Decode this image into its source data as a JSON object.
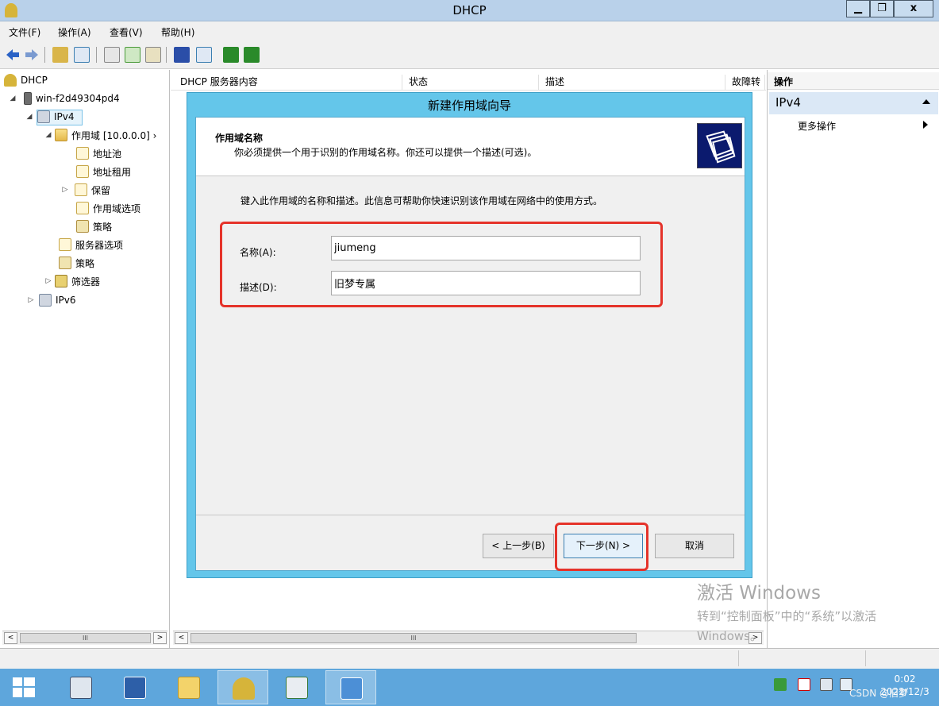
{
  "window": {
    "title": "DHCP",
    "min": "▁",
    "max": "❐",
    "close": "x"
  },
  "menu": [
    "文件(F)",
    "操作(A)",
    "查看(V)",
    "帮助(H)"
  ],
  "tree": {
    "root": "DHCP",
    "server": "win-f2d49304pd4",
    "ipv4": "IPv4",
    "scope": "作用域 [10.0.0.0] ›",
    "address_pool": "地址池",
    "address_leases": "地址租用",
    "reservations": "保留",
    "scope_options": "作用域选项",
    "policies": "策略",
    "server_options": "服务器选项",
    "policies2": "策略",
    "filters": "筛选器",
    "ipv6": "IPv6"
  },
  "list": {
    "columns": [
      "DHCP 服务器内容",
      "状态",
      "描述",
      "故障转"
    ]
  },
  "actions": {
    "header": "操作",
    "section": "IPv4",
    "more": "更多操作"
  },
  "wizard": {
    "title": "新建作用域向导",
    "heading": "作用域名称",
    "subheading": "你必须提供一个用于识别的作用域名称。你还可以提供一个描述(可选)。",
    "instruction": "键入此作用域的名称和描述。此信息可帮助你快速识别该作用域在网络中的使用方式。",
    "name_label": "名称(A):",
    "name_value": "jiumeng",
    "desc_label": "描述(D):",
    "desc_value": "旧梦专属",
    "back_label": "< 上一步(B)",
    "next_label": "下一步(N) >",
    "cancel_label": "取消"
  },
  "watermark": {
    "line1": "激活 Windows",
    "line2": "转到“控制面板”中的“系统”以激活",
    "line3": "Windows。"
  },
  "taskbar": {
    "time": "0:02",
    "date": "2022/12/3",
    "overlay": "CSDN @旧梦"
  },
  "scroll": {
    "thumb": "III",
    "left": "<",
    "right": ">"
  }
}
